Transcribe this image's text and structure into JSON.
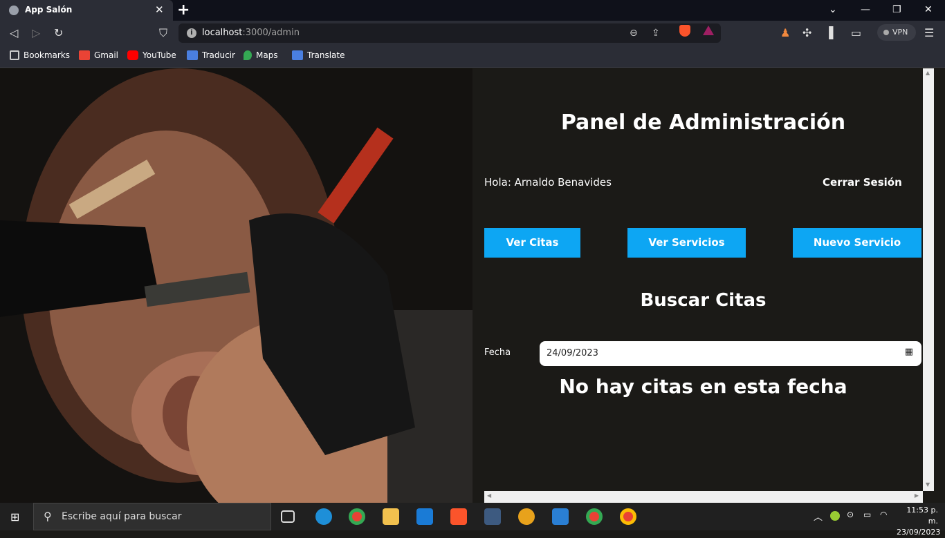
{
  "browser": {
    "tab_title": "App Salón",
    "url_host": "localhost",
    "url_path": ":3000/admin",
    "vpn_label": "VPN",
    "bookmarks": [
      "Bookmarks",
      "Gmail",
      "YouTube",
      "Traducir",
      "Maps",
      "Translate"
    ]
  },
  "page": {
    "title": "Panel de Administración",
    "greeting": "Hola: Arnaldo Benavides",
    "logout": "Cerrar Sesión",
    "nav": [
      "Ver Citas",
      "Ver Servicios",
      "Nuevo Servicio"
    ],
    "search_heading": "Buscar Citas",
    "date_label": "Fecha",
    "date_value": "24/09/2023",
    "empty_message": "No hay citas en esta fecha"
  },
  "colors": {
    "accent": "#0da6f3",
    "background": "#1b1a17"
  },
  "taskbar": {
    "search_placeholder": "Escribe aquí para buscar",
    "time": "11:53 p. m.",
    "date": "23/09/2023"
  }
}
